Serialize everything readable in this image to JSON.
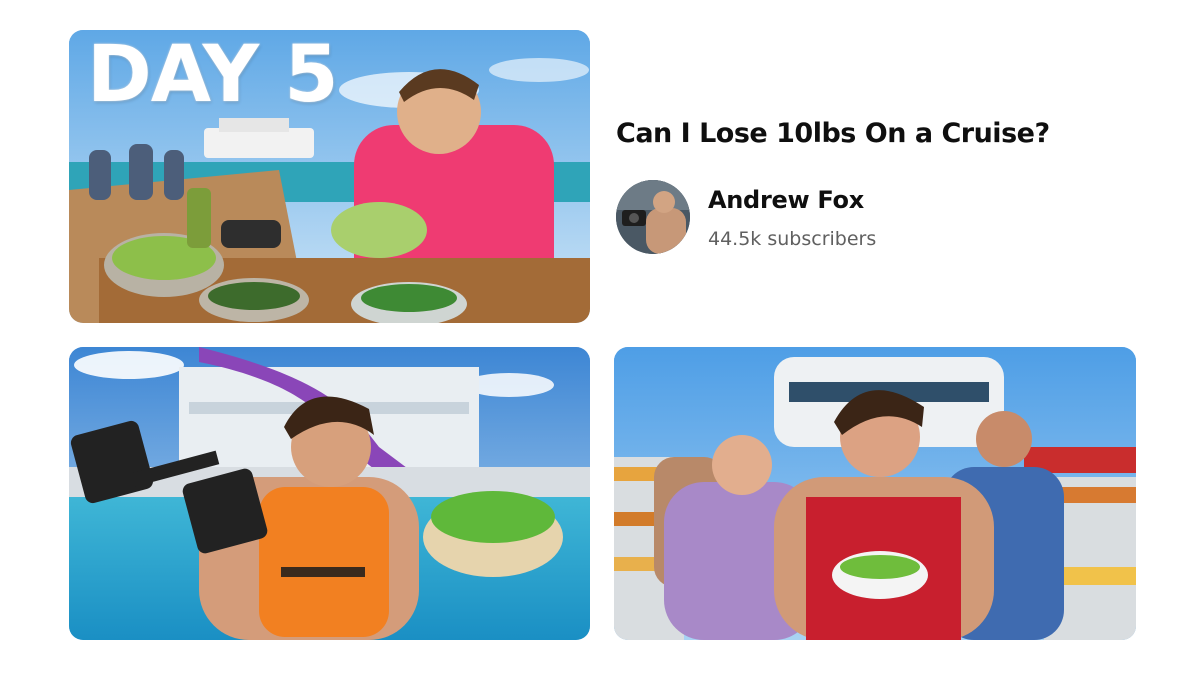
{
  "thumbnails": [
    {
      "overlay_text": "DAY 5",
      "scene": "pier-salad-meal"
    },
    {
      "overlay_text": "",
      "scene": "pool-dumbbell-salad"
    },
    {
      "overlay_text": "",
      "scene": "buffet-salad-bowl"
    }
  ],
  "video": {
    "title": "Can I Lose 10lbs On a Cruise?"
  },
  "channel": {
    "name": "Andrew Fox",
    "subscribers": "44.5k subscribers",
    "avatar_icon": "channel-avatar"
  },
  "colors": {
    "title_text": "#0f0f0f",
    "meta_text": "#606060",
    "background": "#ffffff"
  }
}
